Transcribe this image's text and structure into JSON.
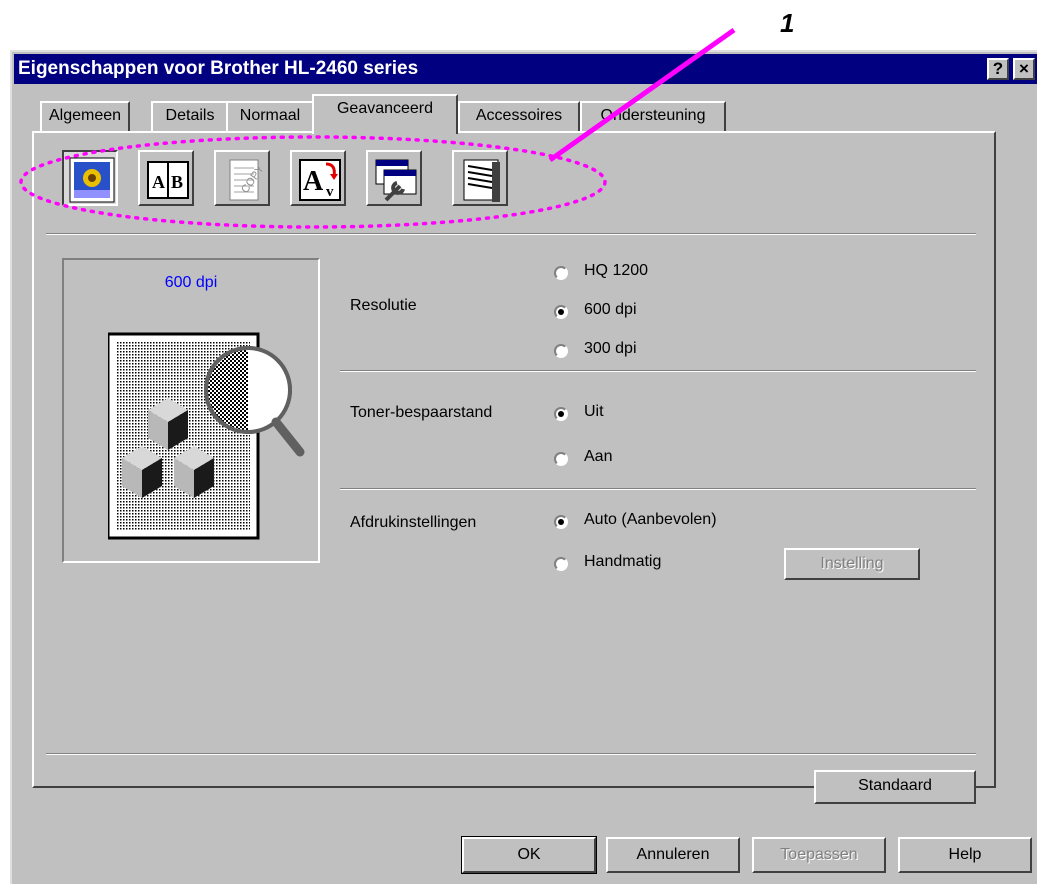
{
  "window": {
    "title": "Eigenschappen voor Brother HL-2460 series",
    "help_glyph": "?",
    "close_glyph": "×"
  },
  "annotation": {
    "label": "1"
  },
  "tabs": [
    {
      "label": "Algemeen",
      "active": false
    },
    {
      "label": "Details",
      "active": false
    },
    {
      "label": "Normaal",
      "active": false
    },
    {
      "label": "Geavanceerd",
      "active": true
    },
    {
      "label": "Accessoires",
      "active": false
    },
    {
      "label": "Ondersteuning",
      "active": false
    }
  ],
  "toolbar_icons": [
    "print-quality-icon",
    "duplex-icon",
    "copy-watermark-icon",
    "font-settings-icon",
    "device-options-icon",
    "paper-tray-icon"
  ],
  "preview": {
    "caption": "600 dpi"
  },
  "resolution": {
    "label": "Resolutie",
    "options": [
      "HQ 1200",
      "600 dpi",
      "300 dpi"
    ],
    "selected": "600 dpi"
  },
  "toner_save": {
    "label": "Toner-bespaarstand",
    "options": [
      "Uit",
      "Aan"
    ],
    "selected": "Uit"
  },
  "print_settings": {
    "label": "Afdrukinstellingen",
    "options": [
      "Auto (Aanbevolen)",
      "Handmatig"
    ],
    "selected": "Auto (Aanbevolen)",
    "setting_button": "Instelling"
  },
  "buttons": {
    "default": "Standaard",
    "ok": "OK",
    "cancel": "Annuleren",
    "apply": "Toepassen",
    "help": "Help"
  },
  "colors": {
    "titlebar": "#000080",
    "face": "#c0c0c0",
    "annotation": "#ff00ff",
    "preview_caption": "#0000ff"
  }
}
